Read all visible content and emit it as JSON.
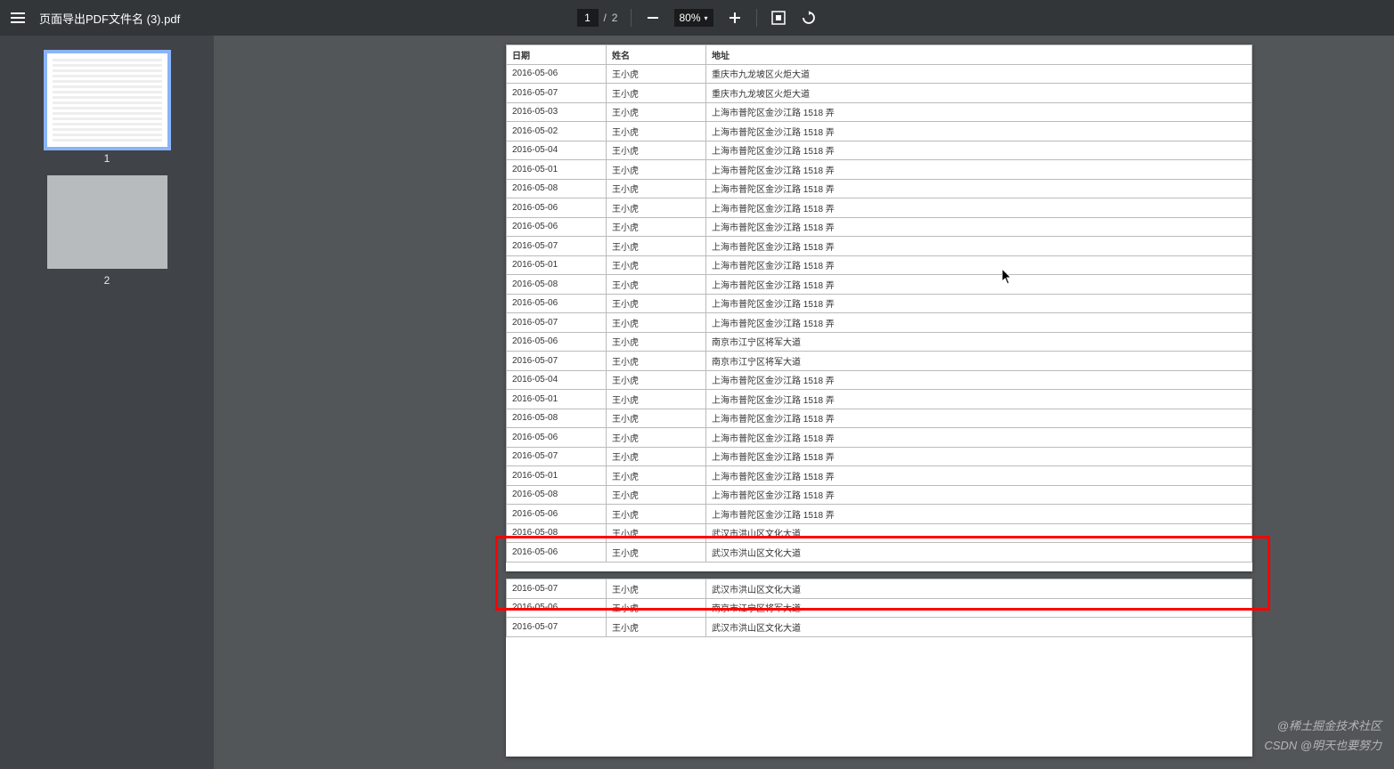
{
  "toolbar": {
    "file_title": "页面导出PDF文件名 (3).pdf",
    "page_current": "1",
    "page_sep": "/",
    "page_total": "2",
    "zoom": "80%"
  },
  "thumbs": {
    "n1": "1",
    "n2": "2"
  },
  "headers": {
    "date": "日期",
    "name": "姓名",
    "addr": "地址"
  },
  "rows": [
    {
      "d": "2016-05-06",
      "n": "王小虎",
      "a": "重庆市九龙坡区火炬大道"
    },
    {
      "d": "2016-05-07",
      "n": "王小虎",
      "a": "重庆市九龙坡区火炬大道"
    },
    {
      "d": "2016-05-03",
      "n": "王小虎",
      "a": "上海市普陀区金沙江路 1518 弄"
    },
    {
      "d": "2016-05-02",
      "n": "王小虎",
      "a": "上海市普陀区金沙江路 1518 弄"
    },
    {
      "d": "2016-05-04",
      "n": "王小虎",
      "a": "上海市普陀区金沙江路 1518 弄"
    },
    {
      "d": "2016-05-01",
      "n": "王小虎",
      "a": "上海市普陀区金沙江路 1518 弄"
    },
    {
      "d": "2016-05-08",
      "n": "王小虎",
      "a": "上海市普陀区金沙江路 1518 弄"
    },
    {
      "d": "2016-05-06",
      "n": "王小虎",
      "a": "上海市普陀区金沙江路 1518 弄"
    },
    {
      "d": "2016-05-06",
      "n": "王小虎",
      "a": "上海市普陀区金沙江路 1518 弄"
    },
    {
      "d": "2016-05-07",
      "n": "王小虎",
      "a": "上海市普陀区金沙江路 1518 弄"
    },
    {
      "d": "2016-05-01",
      "n": "王小虎",
      "a": "上海市普陀区金沙江路 1518 弄"
    },
    {
      "d": "2016-05-08",
      "n": "王小虎",
      "a": "上海市普陀区金沙江路 1518 弄"
    },
    {
      "d": "2016-05-06",
      "n": "王小虎",
      "a": "上海市普陀区金沙江路 1518 弄"
    },
    {
      "d": "2016-05-07",
      "n": "王小虎",
      "a": "上海市普陀区金沙江路 1518 弄"
    },
    {
      "d": "2016-05-06",
      "n": "王小虎",
      "a": "南京市江宁区将军大道"
    },
    {
      "d": "2016-05-07",
      "n": "王小虎",
      "a": "南京市江宁区将军大道"
    },
    {
      "d": "2016-05-04",
      "n": "王小虎",
      "a": "上海市普陀区金沙江路 1518 弄"
    },
    {
      "d": "2016-05-01",
      "n": "王小虎",
      "a": "上海市普陀区金沙江路 1518 弄"
    },
    {
      "d": "2016-05-08",
      "n": "王小虎",
      "a": "上海市普陀区金沙江路 1518 弄"
    },
    {
      "d": "2016-05-06",
      "n": "王小虎",
      "a": "上海市普陀区金沙江路 1518 弄"
    },
    {
      "d": "2016-05-07",
      "n": "王小虎",
      "a": "上海市普陀区金沙江路 1518 弄"
    },
    {
      "d": "2016-05-01",
      "n": "王小虎",
      "a": "上海市普陀区金沙江路 1518 弄"
    },
    {
      "d": "2016-05-08",
      "n": "王小虎",
      "a": "上海市普陀区金沙江路 1518 弄"
    },
    {
      "d": "2016-05-06",
      "n": "王小虎",
      "a": "上海市普陀区金沙江路 1518 弄"
    },
    {
      "d": "2016-05-08",
      "n": "王小虎",
      "a": "武汉市洪山区文化大道"
    },
    {
      "d": "2016-05-06",
      "n": "王小虎",
      "a": "武汉市洪山区文化大道"
    }
  ],
  "rows2": [
    {
      "d": "2016-05-07",
      "n": "王小虎",
      "a": "武汉市洪山区文化大道"
    },
    {
      "d": "2016-05-06",
      "n": "王小虎",
      "a": "南京市江宁区将军大道"
    },
    {
      "d": "2016-05-07",
      "n": "王小虎",
      "a": "武汉市洪山区文化大道"
    }
  ],
  "watermark": {
    "w1": "@稀土掘金技术社区",
    "w2": "CSDN @明天也要努力"
  }
}
